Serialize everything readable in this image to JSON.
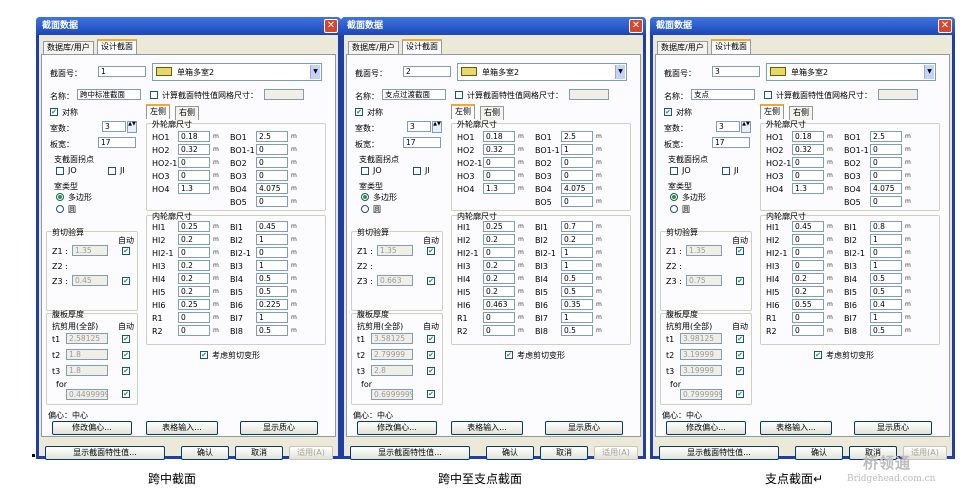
{
  "labels": {
    "title": "截面数据",
    "tab_db": "数据库/用户",
    "tab_design": "设计截面",
    "section_no": "截面号：",
    "box_type": "单箱多室2",
    "name": "名称：",
    "calc_grid": "计算截面特性值网格尺寸：",
    "symmetric": "对称",
    "left": "左侧",
    "right": "右侧",
    "cells": "室数：",
    "slab_width": "板宽：",
    "pivot_title": "支截面拐点",
    "jo": "JO",
    "ji": "JI",
    "cell_type": "室类型",
    "polygon": "多边形",
    "circle": "圆",
    "shear_title": "剪切验算",
    "auto": "自动",
    "z1": "Z1 :",
    "z2": "Z2 :",
    "z3": "Z3 :",
    "web_title1": "腹板厚度",
    "web_title2": "抗剪用(全部)",
    "t1": "t1",
    "t2": "t2",
    "t3": "t3",
    "tor": "for",
    "outer": "外轮廓尺寸",
    "inner": "内轮廓尺寸",
    "unit": "m",
    "consider_shear": "考虑剪切变形",
    "offset": "偏心：",
    "offset_val": "中心",
    "modify_offset": "修改偏心...",
    "table_input": "表格输入...",
    "show_centroid": "显示质心",
    "show_props": "显示截面特性值...",
    "ok": "确认",
    "cancel": "取消",
    "apply": "适用(A)",
    "ho_labels": [
      "HO1",
      "HO2",
      "HO2-1",
      "HO3",
      "HO4"
    ],
    "bo_labels": [
      "BO1",
      "BO1-1",
      "BO2",
      "BO3",
      "BO4",
      "BO5"
    ],
    "hi_labels": [
      "HI1",
      "HI2",
      "HI2-1",
      "HI3",
      "HI4",
      "HI5",
      "HI6",
      "R1",
      "R2"
    ],
    "bi_labels": [
      "BI1",
      "BI2",
      "BI2-1",
      "BI3",
      "BI4",
      "BI5",
      "BI6",
      "BI7",
      "BI8"
    ]
  },
  "dialogs": [
    {
      "section_no": "1",
      "name": "跨中标准截面",
      "cells": "3",
      "slab_width": "17",
      "ho": [
        "0.18",
        "0.32",
        "0",
        "0",
        "1.3"
      ],
      "bo": [
        "2.5",
        "0",
        "0",
        "0",
        "4.075",
        "0"
      ],
      "hi": [
        "0.25",
        "0.2",
        "0",
        "0.2",
        "0.2",
        "0.2",
        "0.25",
        "0",
        "0"
      ],
      "bi": [
        "0.45",
        "1",
        "0",
        "1",
        "0.5",
        "0.5",
        "0.225",
        "1",
        "0.5"
      ],
      "z1": "1.35",
      "z3": "0.45",
      "t1": "2.58125",
      "t2": "1.8",
      "t3": "1.8",
      "tor": "0.449999999"
    },
    {
      "section_no": "2",
      "name": "支点过渡截面",
      "cells": "3",
      "slab_width": "17",
      "ho": [
        "0.18",
        "0.32",
        "0",
        "0",
        "1.3"
      ],
      "bo": [
        "2.5",
        "1",
        "0",
        "0",
        "4.075",
        "0"
      ],
      "hi": [
        "0.25",
        "0.2",
        "0",
        "0.2",
        "0.2",
        "0.2",
        "0.463",
        "0",
        "0"
      ],
      "bi": [
        "0.7",
        "0.2",
        "1",
        "1",
        "0.5",
        "0.5",
        "0.35",
        "1",
        "0.5"
      ],
      "z1": "1.35",
      "z3": "0.663",
      "t1": "3.58125",
      "t2": "2.79999",
      "t3": "2.8",
      "tor": "0.69999999"
    },
    {
      "section_no": "3",
      "name": "支点",
      "cells": "3",
      "slab_width": "17",
      "ho": [
        "0.18",
        "0.32",
        "0",
        "0",
        "1.3"
      ],
      "bo": [
        "2.5",
        "0",
        "0",
        "0",
        "4.075",
        "0"
      ],
      "hi": [
        "0.45",
        "0",
        "0",
        "0",
        "0.2",
        "0.2",
        "0.55",
        "0",
        "0"
      ],
      "bi": [
        "0.8",
        "1",
        "0",
        "1",
        "0.5",
        "0.5",
        "0.4",
        "1",
        "0.5"
      ],
      "z1": "1.35",
      "z3": "0.75",
      "t1": "3.98125",
      "t2": "3.19999",
      "t3": "3.19999",
      "tor": "0.79999999"
    }
  ],
  "captions": [
    "跨中截面",
    "跨中至支点截面",
    "支点截面↵"
  ],
  "watermark": {
    "cn": "桥领通",
    "en": "Bridgehead.com.cn"
  }
}
